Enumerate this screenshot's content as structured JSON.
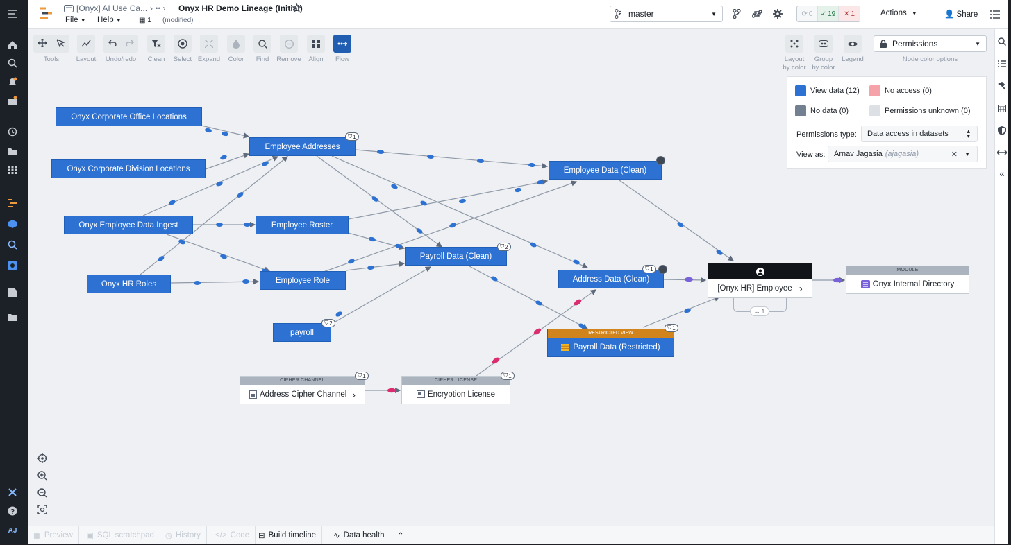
{
  "header": {
    "breadcrumb_folder": "[Onyx] AI Use Ca...",
    "breadcrumb_more": "•••",
    "title": "Onyx HR Demo Lineage (Initial)",
    "menu_file": "File",
    "menu_help": "Help",
    "collab_count": "1",
    "modified": "(modified)",
    "branch": "master",
    "status_sync": "0",
    "status_ok": "19",
    "status_err": "1",
    "actions": "Actions",
    "share": "Share"
  },
  "toolbar": {
    "tools": "Tools",
    "layout": "Layout",
    "undo_redo": "Undo/redo",
    "clean": "Clean",
    "select": "Select",
    "expand": "Expand",
    "color": "Color",
    "find": "Find",
    "remove": "Remove",
    "align": "Align",
    "flow": "Flow"
  },
  "color_options": {
    "layout_by_color_1": "Layout",
    "layout_by_color_2": "by color",
    "group_by_color_1": "Group",
    "group_by_color_2": "by color",
    "legend": "Legend",
    "dropdown_value": "Permissions",
    "caption": "Node color options"
  },
  "legend_panel": {
    "view_data": "View data (12)",
    "no_access": "No access (0)",
    "no_data": "No data (0)",
    "permissions_unknown": "Permissions unknown (0)",
    "permissions_type_label": "Permissions type:",
    "permissions_type_value": "Data access in datasets",
    "view_as_label": "View as:",
    "view_as_name": "Arnav Jagasia",
    "view_as_user": "(ajagasia)",
    "colors": {
      "view_data": "#2d72d2",
      "no_access": "#f5a3a8",
      "no_data": "#738091",
      "unknown": "#dde1e6"
    }
  },
  "nodes": {
    "corp_office": "Onyx Corporate Office Locations",
    "corp_division": "Onyx Corporate Division Locations",
    "employee_data_ingest": "Onyx Employee Data Ingest",
    "hr_roles": "Onyx HR Roles",
    "employee_addresses": "Employee Addresses",
    "employee_roster": "Employee Roster",
    "employee_role": "Employee Role",
    "payroll": "payroll",
    "employee_data_clean": "Employee Data (Clean)",
    "payroll_data_clean": "Payroll Data (Clean)",
    "address_data_clean": "Address Data (Clean)",
    "restricted_caption": "RESTRICTED VIEW",
    "payroll_restricted": "Payroll Data (Restricted)",
    "cipher_channel_caption": "CIPHER CHANNEL",
    "address_cipher_channel": "Address Cipher Channel",
    "cipher_license_caption": "CIPHER LICENSE",
    "encryption_license": "Encryption License",
    "onyx_hr_employee": "[Onyx HR] Employee",
    "group_count": "1",
    "module_caption": "MODULE",
    "onyx_internal_directory": "Onyx Internal Directory"
  },
  "badges": {
    "employee_addresses": "1",
    "payroll_data_clean": "2",
    "address_data_clean": "1",
    "payroll": "2",
    "payroll_restricted": "1",
    "address_cipher_channel": "1",
    "encryption_license": "1"
  },
  "bottom_bar": {
    "preview": "Preview",
    "sql_scratchpad": "SQL scratchpad",
    "history": "History",
    "code": "Code",
    "build_timeline": "Build timeline",
    "data_health": "Data health"
  },
  "user_initials": "AJ"
}
